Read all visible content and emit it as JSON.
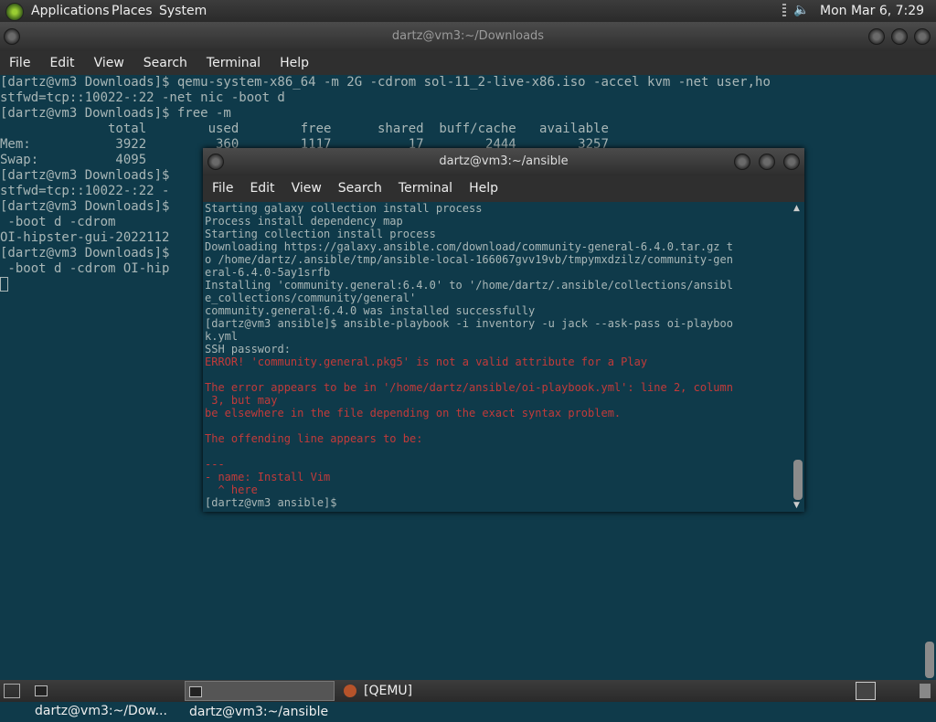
{
  "top_panel": {
    "applications": "Applications",
    "places": "Places",
    "system": "System",
    "clock": "Mon Mar  6,  7:29 PM",
    "icons": [
      "apps-logo-icon",
      "volume-icon"
    ]
  },
  "main_window": {
    "title": "dartz@vm3:~/Downloads",
    "menu": [
      "File",
      "Edit",
      "View",
      "Search",
      "Terminal",
      "Help"
    ],
    "lines": [
      "[dartz@vm3 Downloads]$ qemu-system-x86_64 -m 2G -cdrom sol-11_2-live-x86.iso -accel kvm -net user,ho",
      "stfwd=tcp::10022-:22 -net nic -boot d",
      "[dartz@vm3 Downloads]$ free -m",
      "              total        used        free      shared  buff/cache   available",
      "Mem:           3922         360        1117          17        2444        3257",
      "Swap:          4095",
      "[dartz@vm3 Downloads]$                                                               -net user,ho",
      "stfwd=tcp::10022-:22 -",
      "[dartz@vm3 Downloads]$                                                               :22 -net nic",
      " -boot d -cdrom",
      "OI-hipster-gui-2022112",
      "[dartz@vm3 Downloads]$                                                               :22 -net nic",
      " -boot d -cdrom OI-hip"
    ]
  },
  "ansible_window": {
    "title": "dartz@vm3:~/ansible",
    "menu": [
      "File",
      "Edit",
      "View",
      "Search",
      "Terminal",
      "Help"
    ],
    "lines": [
      {
        "t": "Starting galaxy collection install process",
        "err": false
      },
      {
        "t": "Process install dependency map",
        "err": false
      },
      {
        "t": "Starting collection install process",
        "err": false
      },
      {
        "t": "Downloading https://galaxy.ansible.com/download/community-general-6.4.0.tar.gz t",
        "err": false
      },
      {
        "t": "o /home/dartz/.ansible/tmp/ansible-local-166067gvv19vb/tmpymxdzilz/community-gen",
        "err": false
      },
      {
        "t": "eral-6.4.0-5ay1srfb",
        "err": false
      },
      {
        "t": "Installing 'community.general:6.4.0' to '/home/dartz/.ansible/collections/ansibl",
        "err": false
      },
      {
        "t": "e_collections/community/general'",
        "err": false
      },
      {
        "t": "community.general:6.4.0 was installed successfully",
        "err": false
      },
      {
        "t": "[dartz@vm3 ansible]$ ansible-playbook -i inventory -u jack --ask-pass oi-playboo",
        "err": false
      },
      {
        "t": "k.yml",
        "err": false
      },
      {
        "t": "SSH password:",
        "err": false
      },
      {
        "t": "ERROR! 'community.general.pkg5' is not a valid attribute for a Play",
        "err": true
      },
      {
        "t": "",
        "err": true
      },
      {
        "t": "The error appears to be in '/home/dartz/ansible/oi-playbook.yml': line 2, column",
        "err": true
      },
      {
        "t": " 3, but may",
        "err": true
      },
      {
        "t": "be elsewhere in the file depending on the exact syntax problem.",
        "err": true
      },
      {
        "t": "",
        "err": true
      },
      {
        "t": "The offending line appears to be:",
        "err": true
      },
      {
        "t": "",
        "err": true
      },
      {
        "t": "---",
        "err": true
      },
      {
        "t": "- name: Install Vim",
        "err": true
      },
      {
        "t": "  ^ here",
        "err": true
      },
      {
        "t": "[dartz@vm3 ansible]$",
        "err": false
      }
    ]
  },
  "taskbar": {
    "tasks": [
      "dartz@vm3:~/Dow...",
      "dartz@vm3:~/ansible",
      "[QEMU]"
    ]
  }
}
